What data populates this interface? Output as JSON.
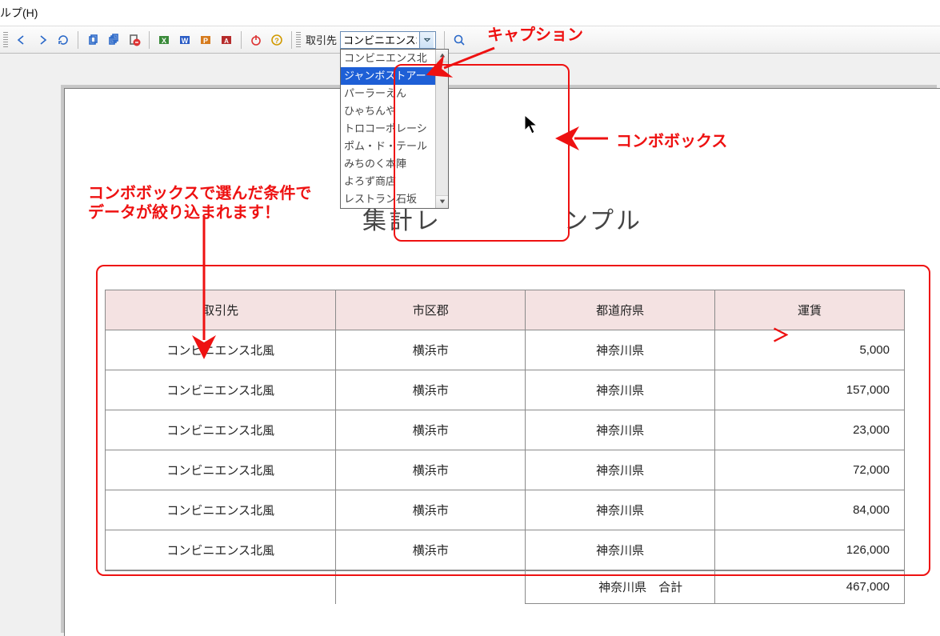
{
  "menu": {
    "help_label": "ルプ(H)"
  },
  "toolbar": {
    "caption_label": "取引先",
    "combo_value": "コンビニエンス北",
    "combo_options": [
      "コンビニエンス北",
      "ジャンボストアー",
      "パーラーえん",
      "ひゃちんや",
      "トロコーポレーシ",
      "ポム・ド・テール",
      "みちのく本陣",
      "よろず商店",
      "レストラン石坂"
    ],
    "combo_selected_index": 1
  },
  "report": {
    "title_visible_left": "集計レ",
    "title_visible_right": "ンプル",
    "columns": [
      "取引先",
      "市区郡",
      "都道府県",
      "運賃"
    ],
    "rows": [
      {
        "partner": "コンビニエンス北風",
        "city": "横浜市",
        "pref": "神奈川県",
        "fare": "5,000"
      },
      {
        "partner": "コンビニエンス北風",
        "city": "横浜市",
        "pref": "神奈川県",
        "fare": "157,000"
      },
      {
        "partner": "コンビニエンス北風",
        "city": "横浜市",
        "pref": "神奈川県",
        "fare": "23,000"
      },
      {
        "partner": "コンビニエンス北風",
        "city": "横浜市",
        "pref": "神奈川県",
        "fare": "72,000"
      },
      {
        "partner": "コンビニエンス北風",
        "city": "横浜市",
        "pref": "神奈川県",
        "fare": "84,000"
      },
      {
        "partner": "コンビニエンス北風",
        "city": "横浜市",
        "pref": "神奈川県",
        "fare": "126,000"
      }
    ],
    "total_label": "神奈川県　合計",
    "total_value": "467,000"
  },
  "annotations": {
    "caption": "キャプション",
    "combobox": "コンボボックス",
    "filter_line1": "コンボボックスで選んだ条件で",
    "filter_line2": "データが絞り込まれます！"
  }
}
